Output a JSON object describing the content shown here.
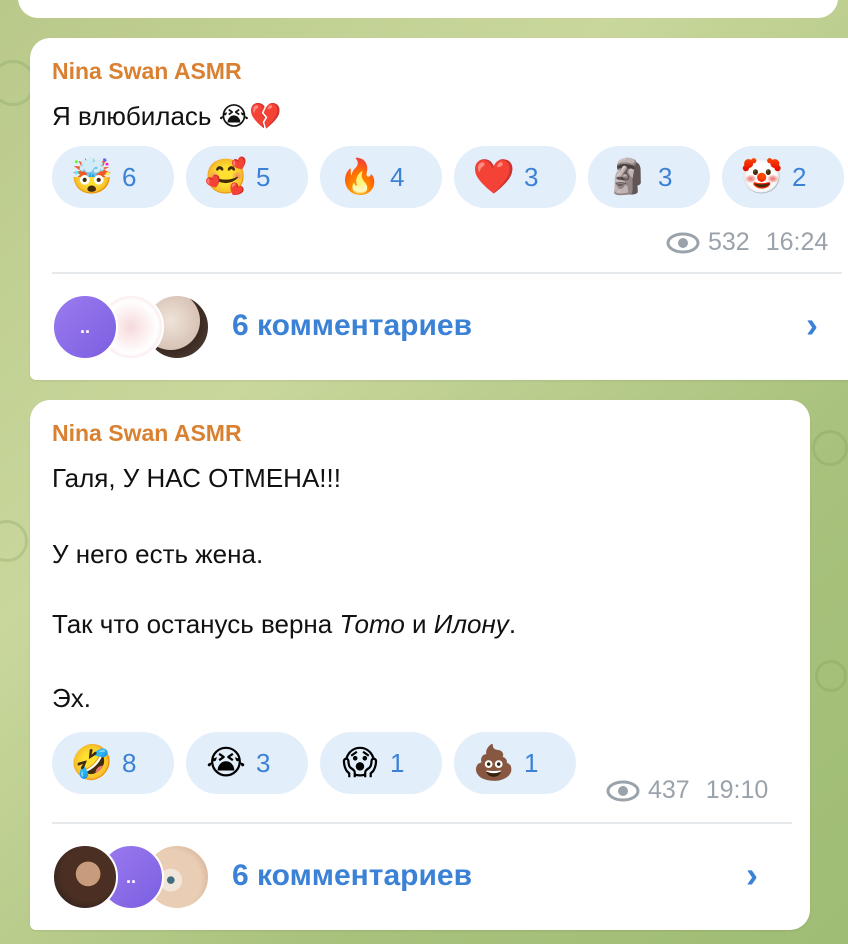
{
  "messages": [
    {
      "author": "Nina Swan ASMR",
      "text": "Я влюбилась 😭💔",
      "reactions": [
        {
          "emoji": "🤯",
          "count": "6"
        },
        {
          "emoji": "🥰",
          "count": "5"
        },
        {
          "emoji": "🔥",
          "count": "4"
        },
        {
          "emoji": "❤️",
          "count": "3"
        },
        {
          "emoji": "🗿",
          "count": "3"
        },
        {
          "emoji": "🤡",
          "count": "2"
        }
      ],
      "views": "532",
      "time": "16:24",
      "comments_label": "6 комментариев"
    },
    {
      "author": "Nina Swan ASMR",
      "lines": {
        "line1": "Галя, У НАС ОТМЕНА!!!",
        "line2": "У него есть жена.",
        "line3_prefix": "Так что останусь верна ",
        "line3_italic1": "Тото",
        "line3_mid": " и ",
        "line3_italic2": "Илону",
        "line3_suffix": ".",
        "line4": "Эх."
      },
      "reactions": [
        {
          "emoji": "🤣",
          "count": "8"
        },
        {
          "emoji": "😭",
          "count": "3"
        },
        {
          "emoji": "😱",
          "count": "1"
        },
        {
          "emoji": "💩",
          "count": "1"
        }
      ],
      "views": "437",
      "time": "19:10",
      "comments_label": "6 комментариев"
    }
  ],
  "avatar_placeholder": "..",
  "colors": {
    "author": "#d98131",
    "accent": "#3b82d6",
    "reaction_bg": "#e3eefb",
    "meta": "#9aa3ab"
  },
  "icons": {
    "views": "eye-icon",
    "open_comments": "chevron-right-icon"
  },
  "chevron_glyph": "›"
}
